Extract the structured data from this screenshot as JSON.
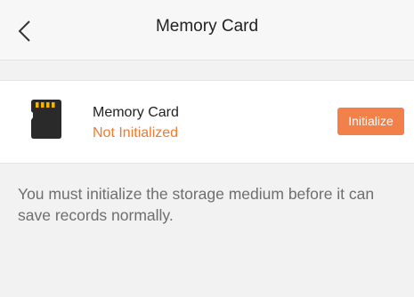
{
  "header": {
    "title": "Memory Card",
    "back_icon": "chevron-left-icon"
  },
  "card": {
    "icon": "sd-card-icon",
    "name": "Memory Card",
    "status": "Not Initialized",
    "status_color": "#f07a2e",
    "initialize_label": "Initialize",
    "initialize_color": "#f2804a"
  },
  "notice": {
    "text": "You must initialize the storage medium before it can save records normally."
  }
}
